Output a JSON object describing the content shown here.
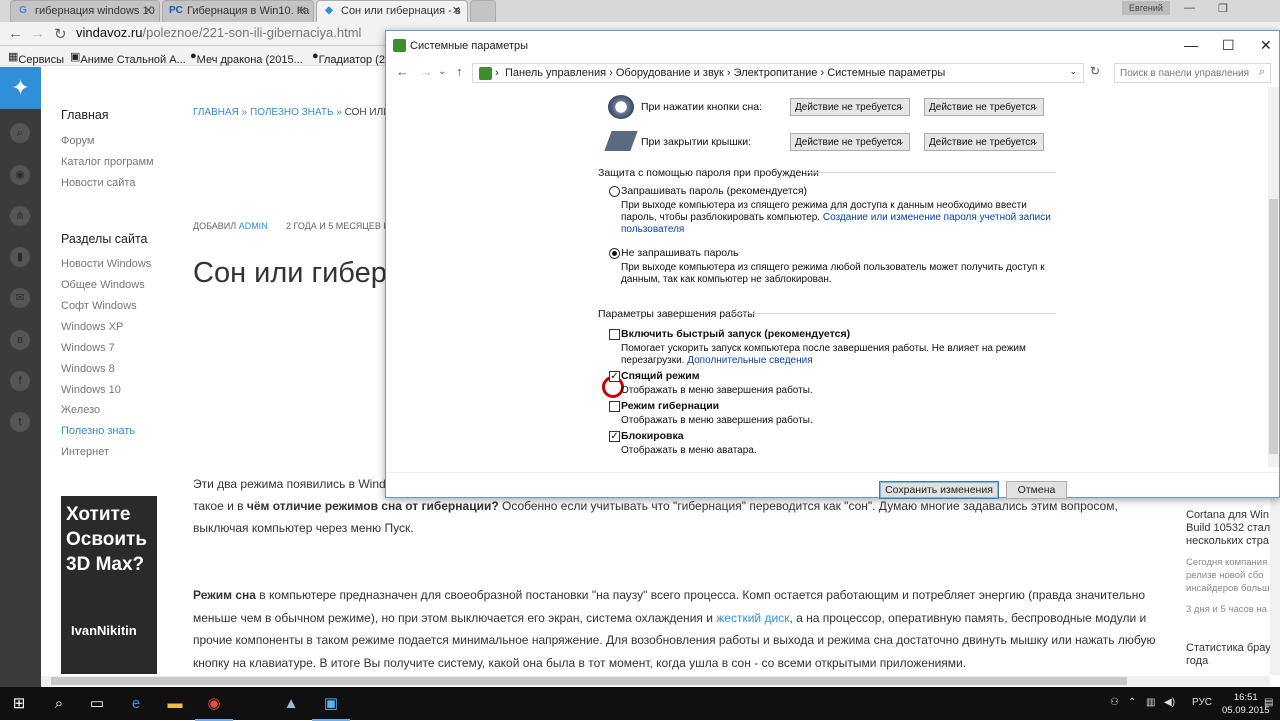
{
  "browser": {
    "tabs": [
      {
        "icon": "G",
        "label": "гибернация windows 10"
      },
      {
        "icon": "PC",
        "label": "Гибернация в Win10. Ка"
      },
      {
        "icon": "◆",
        "label": "Сон или гибернация - в"
      }
    ],
    "user": "Евгений",
    "url_domain": "vindavoz.ru",
    "url_path": "/poleznoe/221-son-ili-gibernaciya.html",
    "bookmarks": [
      "Сервисы",
      "Аниме Стальной А...",
      "Меч дракона (2015...",
      "Гладиатор (2"
    ]
  },
  "site": {
    "nav_home": "Главная",
    "nav_items": [
      "Форум",
      "Каталог программ",
      "Новости сайта"
    ],
    "sections_title": "Разделы сайта",
    "sections": [
      "Новости Windows",
      "Общее Windows",
      "Софт Windows",
      "Windows XP",
      "Windows 7",
      "Windows 8",
      "Windows 10",
      "Железо",
      "Полезно знать",
      "Интернет"
    ],
    "ad_text": "Хотите Освоить 3D Max?",
    "ad_brand": "IvanNikitin"
  },
  "article": {
    "crumb_1": "ГЛАВНАЯ",
    "crumb_sep": " » ",
    "crumb_2": "ПОЛЕЗНО ЗНАТЬ",
    "crumb_3": "СОН ИЛИ Г",
    "added_label": "ДОБАВИЛ ",
    "author": "ADMIN",
    "time": "2 ГОДА И 5 МЕСЯЦЕВ Н",
    "title": "Сон или гиберн",
    "p1_a": "Эти два режима появились в Windo",
    "p1_b_pre": "такое и в ",
    "p1_b_bold": "чём отличие режимов сна от гибернации?",
    "p1_b_post": " Особенно если учитывать что \"гибернация\" переводится как \"сон\". Думаю многие задавались этим вопросом,",
    "p1_c": "выключая компьютер через меню Пуск.",
    "p2_bold": "Режим сна",
    "p2_a": " в компьютере предназначен для своеобразной постановки \"на паузу\" всего процесса. Комп остается работающим и потребляет энергию (правда значительно",
    "p2_b_pre": "меньше чем в обычном режиме), но при этом выключается его экран, система охлаждения и ",
    "p2_b_link": "жесткий диск",
    "p2_b_post": ", а на процессор, оперативную память, беспроводные модули и",
    "p2_c": "прочие компоненты в таком режиме подается минимальное напряжение. Для возобновления работы и выхода и режима сна достаточно двинуть мышку или нажать любую",
    "p2_d": "кнопку на клавиатуре. В итоге Вы получите систему, какой она была в тот момент, когда ушла в сон - со всеми открытыми приложениями."
  },
  "right_col": {
    "item1": "Cortana для Win Build 10532 стал нескольких стра",
    "item1_sub": "Сегодня компания релизе новой сбо инсайдеров больш",
    "item1_time": "3 дня и 5 часов на",
    "item2": "Статистика брау года"
  },
  "dialog": {
    "title": "Системные параметры",
    "path": [
      "Панель управления",
      "Оборудование и звук",
      "Электропитание",
      "Системные параметры"
    ],
    "search_placeholder": "Поиск в панели управления",
    "rows": [
      {
        "label": "При нажатии кнопки сна:",
        "battery": "Действие не требуется",
        "plugged": "Действие не требуется"
      },
      {
        "label": "При закрытии крышки:",
        "battery": "Действие не требуется",
        "plugged": "Действие не требуется"
      }
    ],
    "password_section": "Защита с помощью пароля при пробуждении",
    "radio1_label": "Запрашивать пароль (рекомендуется)",
    "radio1_desc_1": "При выходе компьютера из спящего режима для доступа к данным необходимо ввести",
    "radio1_desc_2_pre": "пароль, чтобы разблокировать компьютер. ",
    "radio1_desc_2_link": "Создание или изменение пароля учетной записи",
    "radio1_desc_3_link": "пользователя",
    "radio2_label": "Не запрашивать пароль",
    "radio2_desc_1": "При выходе компьютера из спящего режима любой пользователь может получить доступ к",
    "radio2_desc_2": "данным, так как компьютер не заблокирован.",
    "shutdown_section": "Параметры завершения работы",
    "opt1_label": "Включить быстрый запуск (рекомендуется)",
    "opt1_desc_1": "Помогает ускорить запуск компьютера после завершения работы. Не влияет на режим",
    "opt1_desc_2_pre": "перезагрузки. ",
    "opt1_desc_2_link": "Дополнительные сведения",
    "opt2_label": "Спящий режим",
    "opt2_desc": "Отображать в меню завершения работы.",
    "opt3_label": "Режим гибернации",
    "opt3_desc": "Отображать в меню завершения работы.",
    "opt4_label": "Блокировка",
    "opt4_desc": "Отображать в меню аватара.",
    "save_label": "Сохранить изменения",
    "cancel_label": "Отмена",
    "checks": {
      "fast_startup": false,
      "sleep": true,
      "hibernate": false,
      "lock": true
    }
  },
  "taskbar": {
    "lang": "РУС",
    "time": "16:51",
    "date": "05.09.2015"
  }
}
